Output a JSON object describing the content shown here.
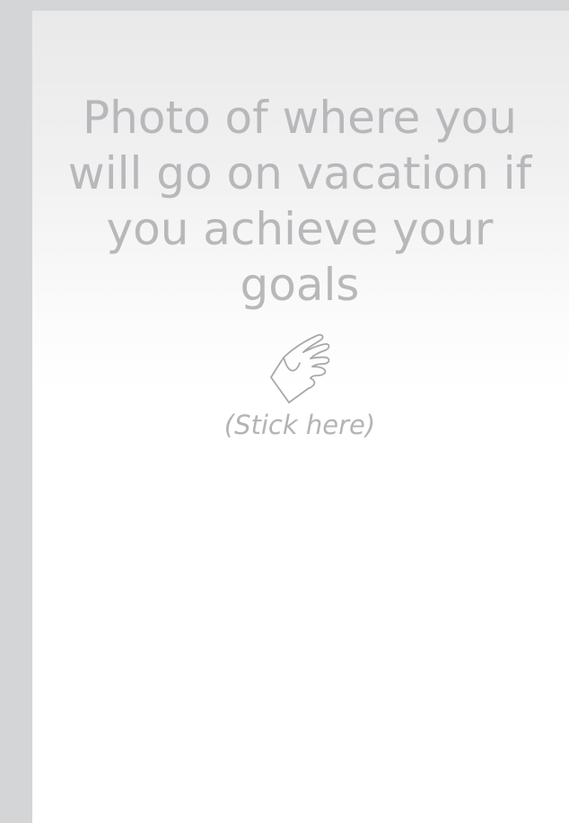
{
  "placeholder": {
    "title": "Photo of where you will go on vacation if you achieve your goals",
    "icon": "pointing-hand-icon",
    "hint": "(Stick here)"
  },
  "colors": {
    "background": "#d4d5d7",
    "page": "#ffffff",
    "text": "#b8b8ba"
  }
}
